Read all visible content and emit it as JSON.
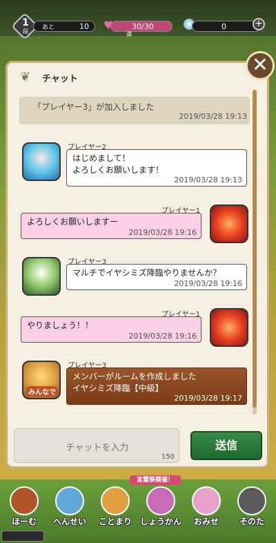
{
  "status": {
    "rank_value": "1",
    "rank_sub": "段",
    "remaining_label": "あと",
    "remaining_value": "10",
    "stamina_value": "30/30",
    "stamina_sub": "満",
    "gems_value": "0",
    "heart_icon": "heart-icon",
    "gem_icon": "gem-icon",
    "plus_icon": "plus-icon"
  },
  "panel": {
    "title": "チャット",
    "close_icon": "close-icon",
    "title_icon": "leaf-icon"
  },
  "messages": [
    {
      "type": "system",
      "text": "「プレイヤー3」が加入しました",
      "time": "2019/03/28 19:13"
    },
    {
      "type": "left",
      "name": "プレイヤー2",
      "text": "はじめまして！\nよろしくお願いします！",
      "time": "2019/03/28 19:13"
    },
    {
      "type": "right",
      "name": "プレイヤー1",
      "text": "よろしくお願いしますー",
      "time": "2019/03/28 19:16"
    },
    {
      "type": "left",
      "name": "プレイヤー3",
      "text": "マルチでイヤシミズ降臨やりませんか？",
      "time": "2019/03/28 19:16"
    },
    {
      "type": "right",
      "name": "プレイヤー1",
      "text": "やりましょう！！",
      "time": "2019/03/28 19:16"
    },
    {
      "type": "left-room",
      "name": "プレイヤー3",
      "avatar_label": "みんなで",
      "text": "メンバーがルームを作成しました\nイヤシミズ降臨【中級】",
      "time": "2019/03/28 19:17"
    }
  ],
  "input": {
    "placeholder": "チャットを入力",
    "count": "150",
    "send_label": "送信"
  },
  "banner": "言霊祭開催！",
  "nav": [
    {
      "label": "ほーむ",
      "icon": "home-icon"
    },
    {
      "label": "へんせい",
      "icon": "team-icon"
    },
    {
      "label": "ことまり",
      "icon": "quest-icon"
    },
    {
      "label": "しょうかん",
      "icon": "summon-icon"
    },
    {
      "label": "おみせ",
      "icon": "shop-icon"
    },
    {
      "label": "そのた",
      "icon": "other-icon"
    }
  ]
}
